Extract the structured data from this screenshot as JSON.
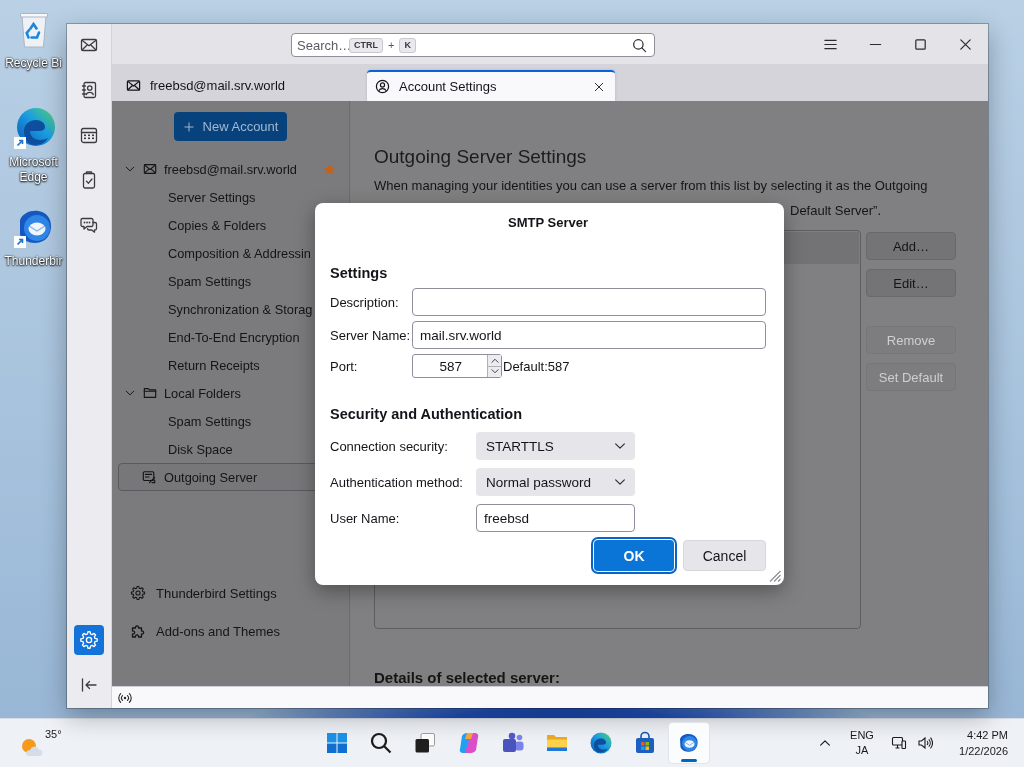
{
  "desktop_icons": [
    {
      "kind": "recycle-bin",
      "label": "Recycle Bi"
    },
    {
      "kind": "edge",
      "label": "Microsoft Edge"
    },
    {
      "kind": "thunderbird",
      "label": "Thunderbir"
    }
  ],
  "spaces_bar": {
    "items": [
      {
        "kind": "mail",
        "selected": false
      },
      {
        "kind": "address-book",
        "selected": false
      },
      {
        "kind": "calendar",
        "selected": false
      },
      {
        "kind": "tasks",
        "selected": false
      },
      {
        "kind": "chat",
        "selected": false
      }
    ],
    "bottom_items": [
      {
        "kind": "settings",
        "selected": true
      },
      {
        "kind": "collapse",
        "selected": false
      }
    ]
  },
  "title_bar": {
    "search": {
      "placeholder": "Search…",
      "shortcut": [
        {
          "kind": "key",
          "text": "CTRL"
        },
        {
          "kind": "plus",
          "text": "+"
        },
        {
          "kind": "key",
          "text": "K"
        }
      ]
    },
    "controls": [
      {
        "kind": "menu"
      },
      {
        "kind": "minimize"
      },
      {
        "kind": "maximize"
      },
      {
        "kind": "close"
      }
    ]
  },
  "tabs": [
    {
      "kind": "mail",
      "label": "freebsd@mail.srv.world",
      "selected": false,
      "closable": false
    },
    {
      "kind": "account",
      "label": "Account Settings",
      "selected": true,
      "closable": true
    }
  ],
  "sidebar": {
    "new_account_button": "New Account",
    "tree": [
      {
        "kind": "mail",
        "label": "freebsd@mail.srv.world",
        "selected": false,
        "expanded": true,
        "default": true,
        "children": [
          {
            "label": "Server Settings",
            "selected": false
          },
          {
            "label": "Copies & Folders",
            "selected": false
          },
          {
            "label": "Composition & Addressin",
            "selected": false
          },
          {
            "label": "Spam Settings",
            "selected": false
          },
          {
            "label": "Synchronization & Storag",
            "selected": false
          },
          {
            "label": "End-To-End Encryption",
            "selected": false
          },
          {
            "label": "Return Receipts",
            "selected": false
          }
        ]
      },
      {
        "kind": "folder",
        "label": "Local Folders",
        "selected": false,
        "expanded": true,
        "default": false,
        "children": [
          {
            "label": "Spam Settings",
            "selected": false
          },
          {
            "label": "Disk Space",
            "selected": false
          }
        ]
      },
      {
        "kind": "outgoing",
        "label": "Outgoing Server",
        "selected": true
      }
    ],
    "footer": [
      {
        "kind": "settings",
        "label": "Thunderbird Settings"
      },
      {
        "kind": "addons",
        "label": "Add-ons and Themes"
      }
    ]
  },
  "main": {
    "heading": "Outgoing Server Settings",
    "description": "When managing your identities you can use a server from this list by selecting it as the Outgoing",
    "description_continued": "Default Server”.",
    "server_list": {
      "rows": [
        {
          "selected": true
        }
      ]
    },
    "buttons": [
      {
        "label": "Add…",
        "disabled": false
      },
      {
        "label": "Edit…",
        "disabled": false
      },
      {
        "label": "Remove",
        "disabled": true
      },
      {
        "label": "Set Default",
        "disabled": true
      }
    ],
    "details_heading": "Details of selected server:"
  },
  "dialog": {
    "title": "SMTP Server",
    "settings_heading": "Settings",
    "settings_fields": [
      {
        "kind": "text",
        "label": "Description:"
      },
      {
        "kind": "text",
        "label": "Server Name:",
        "value": "mail.srv.world"
      },
      {
        "kind": "number",
        "label": "Port:",
        "value": "587",
        "note": "Default:587"
      }
    ],
    "security_heading": "Security and Authentication",
    "security_fields": [
      {
        "kind": "select",
        "label": "Connection security:",
        "value": "STARTTLS"
      },
      {
        "kind": "select",
        "label": "Authentication method:",
        "value": "Normal password"
      },
      {
        "kind": "text",
        "label": "User Name:",
        "value": "freebsd"
      }
    ],
    "buttons": [
      {
        "kind": "primary",
        "label": "OK",
        "focused": true
      },
      {
        "kind": "secondary",
        "label": "Cancel",
        "focused": false
      }
    ]
  },
  "status_bar": {
    "online": true
  },
  "taskbar": {
    "weather": {
      "temperature": "35°"
    },
    "apps": [
      {
        "kind": "start",
        "selected": false
      },
      {
        "kind": "search",
        "selected": false
      },
      {
        "kind": "task-view",
        "selected": false
      },
      {
        "kind": "copilot",
        "selected": false
      },
      {
        "kind": "teams",
        "selected": false
      },
      {
        "kind": "file-explorer",
        "selected": false
      },
      {
        "kind": "edge",
        "selected": false
      },
      {
        "kind": "store",
        "selected": false
      },
      {
        "kind": "thunderbird",
        "selected": true
      }
    ],
    "tray": [
      {
        "kind": "overflow"
      },
      {
        "kind": "language",
        "lines": [
          "ENG",
          "JA"
        ]
      },
      {
        "kind": "network"
      },
      {
        "kind": "volume"
      },
      {
        "kind": "clock",
        "lines": [
          "4:42 PM",
          "1/22/2026"
        ]
      }
    ]
  }
}
